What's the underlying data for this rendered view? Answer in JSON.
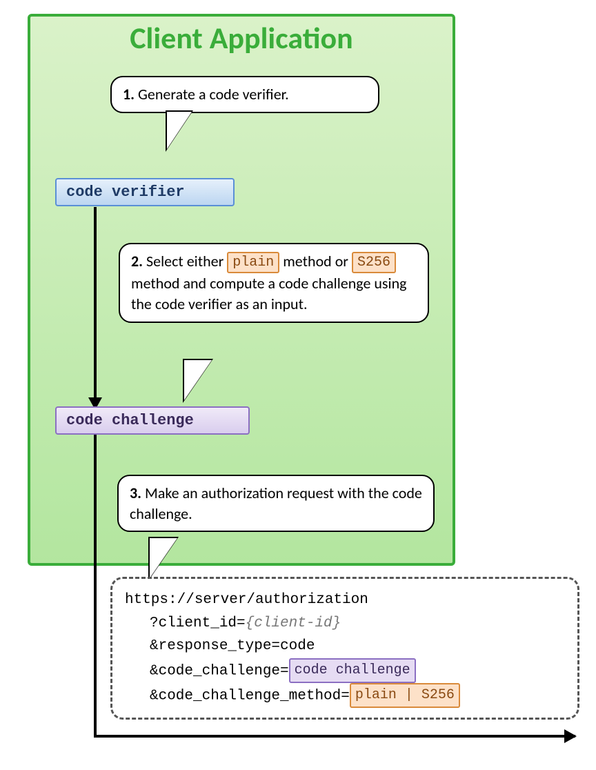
{
  "title": "Client Application",
  "steps": {
    "s1": {
      "num": "1.",
      "text": "Generate a code verifier."
    },
    "s2": {
      "num": "2.",
      "pre": "Select either ",
      "chip1": "plain",
      "mid1": " method or ",
      "chip2": "S256",
      "post": " method and compute a code challenge using the code verifier as an input."
    },
    "s3": {
      "num": "3.",
      "text": "Make an authorization request with the code challenge."
    }
  },
  "boxes": {
    "verifier": "code verifier",
    "challenge": "code challenge"
  },
  "request": {
    "line1": "https://server/authorization",
    "line2a": "?client_id=",
    "line2b": "{client-id}",
    "line3": "&response_type=code",
    "line4a": "&code_challenge=",
    "line4chip": "code challenge",
    "line5a": "&code_challenge_method=",
    "line5chip": "plain | S256"
  }
}
